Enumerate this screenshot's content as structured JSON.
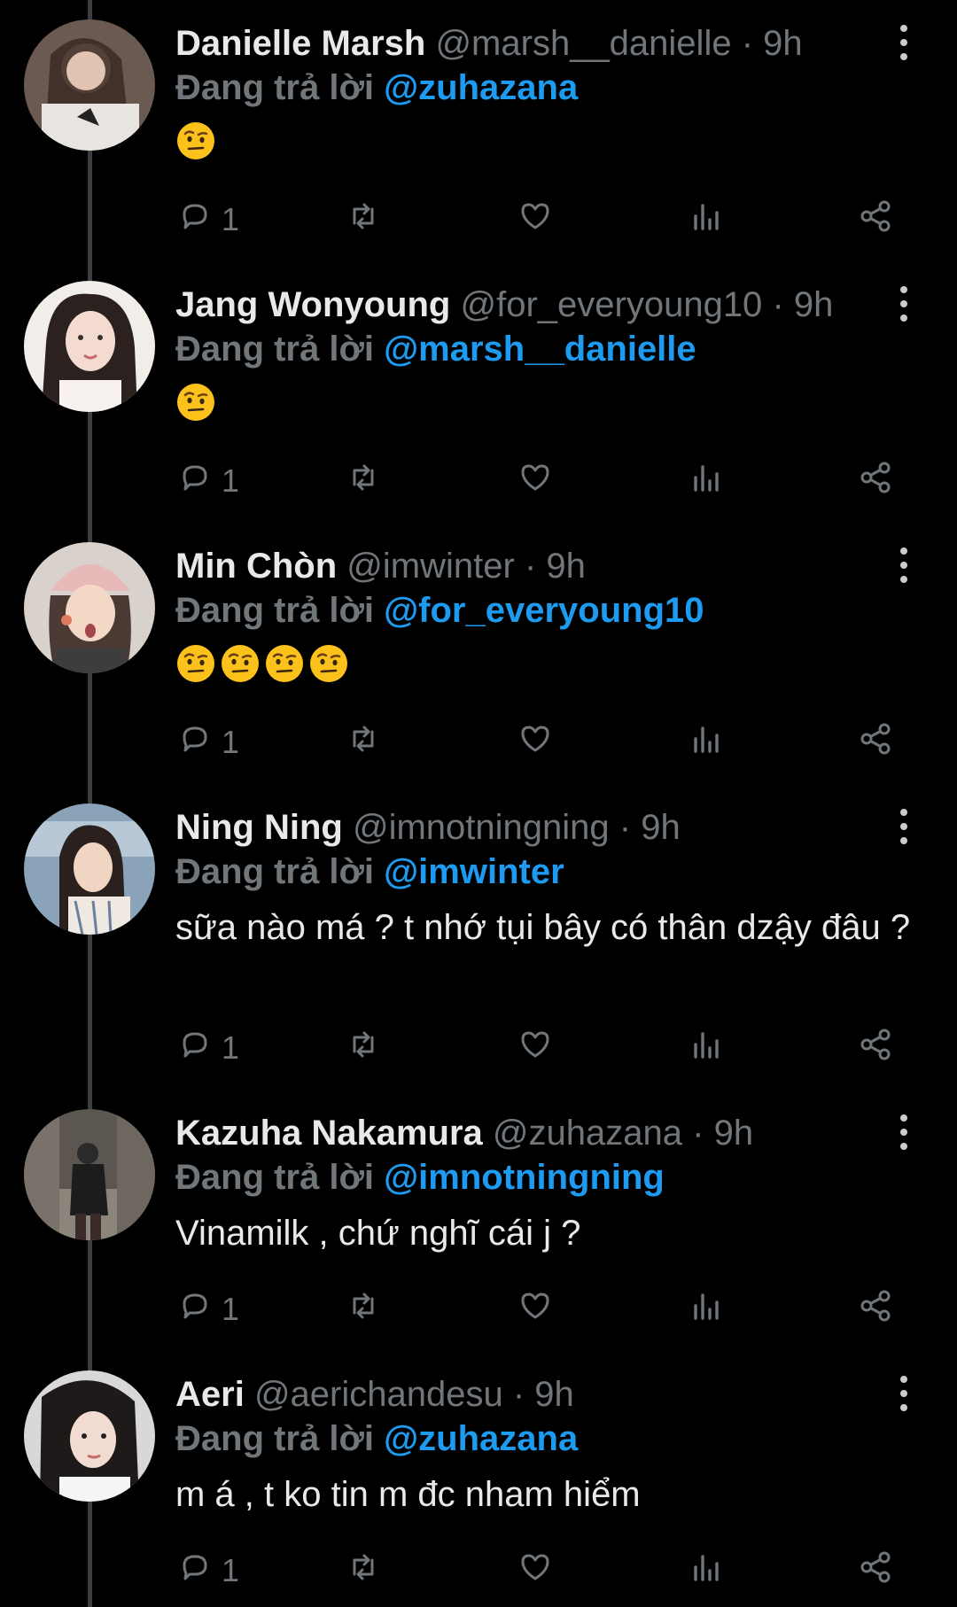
{
  "reply_prefix": "Đang trả lời",
  "separator": "·",
  "icons": {
    "reply": "reply-icon",
    "retweet": "retweet-icon",
    "like": "heart-icon",
    "views": "analytics-icon",
    "share": "share-icon",
    "more": "more-vertical-icon"
  },
  "colors": {
    "background": "#000000",
    "text": "#e7e9ea",
    "secondary": "#71767b",
    "mention": "#1d9bf0",
    "thread_line": "#3a3f44"
  },
  "tweets": [
    {
      "name": "Danielle Marsh",
      "handle": "@marsh__danielle",
      "time": "9h",
      "reply_to": "@zuhazana",
      "text": "",
      "emoji_count": 1,
      "reply_count": "1"
    },
    {
      "name": "Jang Wonyoung",
      "handle": "@for_everyoung10",
      "time": "9h",
      "reply_to": "@marsh__danielle",
      "text": "",
      "emoji_count": 1,
      "reply_count": "1"
    },
    {
      "name": "Min Chòn",
      "handle": "@imwinter",
      "time": "9h",
      "reply_to": "@for_everyoung10",
      "text": "",
      "emoji_count": 4,
      "reply_count": "1"
    },
    {
      "name": "Ning Ning",
      "handle": "@imnotningning",
      "time": "9h",
      "reply_to": "@imwinter",
      "text": "sữa nào má ? t nhớ tụi bây có thân dzậy đâu ?",
      "emoji_count": 0,
      "reply_count": "1"
    },
    {
      "name": "Kazuha Nakamura",
      "handle": "@zuhazana",
      "time": "9h",
      "reply_to": "@imnotningning",
      "text": "Vinamilk , chứ nghĩ cái j ?",
      "emoji_count": 0,
      "reply_count": "1"
    },
    {
      "name": "Aeri",
      "handle": "@aerichandesu",
      "time": "9h",
      "reply_to": "@zuhazana",
      "text": "m á , t ko tin m đc nham hiểm",
      "emoji_count": 0,
      "reply_count": "1"
    }
  ]
}
